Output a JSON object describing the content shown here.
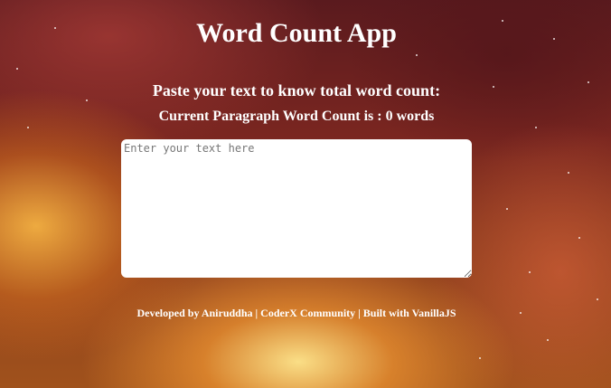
{
  "app": {
    "title": "Word Count App"
  },
  "instructions": {
    "prompt": "Paste your text to know total word count:",
    "count_prefix": "Current Paragraph Word Count is : ",
    "count_value": "0",
    "count_suffix": " words"
  },
  "editor": {
    "placeholder": "Enter your text here",
    "value": ""
  },
  "footer": {
    "text": "Developed by Aniruddha | CoderX Community | Built with VanillaJS"
  },
  "colors": {
    "text": "#ffffff",
    "textarea_bg": "#ffffff"
  }
}
